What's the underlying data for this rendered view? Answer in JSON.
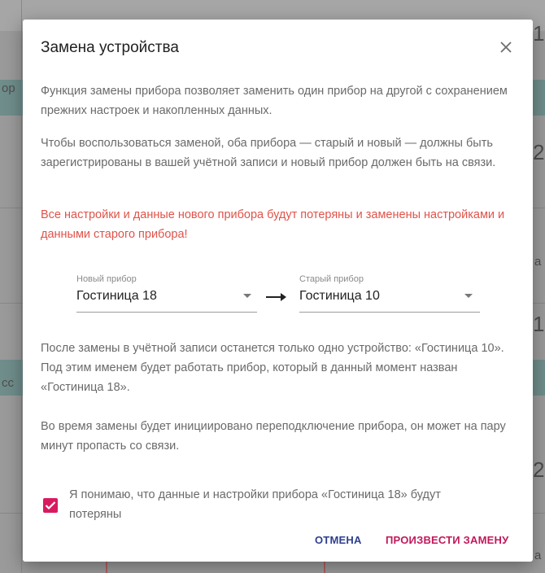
{
  "background": {
    "right_fragments": [
      "1",
      "2",
      "1",
      "2",
      "а",
      "а"
    ],
    "left_fragments": [
      "ор",
      "сс"
    ]
  },
  "dialog": {
    "title": "Замена устройства",
    "close_icon": "close-icon",
    "paragraph_1": "Функция замены прибора позволяет заменить один прибор на другой с сохранением прежних настроек и накопленных данных.",
    "paragraph_2": "Чтобы воспользоваться заменой, оба прибора — старый и новый — должны быть зарегистрированы в вашей учётной записи и новый прибор должен быть на связи.",
    "warning": "Все настройки и данные нового прибора будут потеряны и заменены настройками и данными старого прибора!",
    "new_device": {
      "label": "Новый прибор",
      "value": "Гостиница 18"
    },
    "old_device": {
      "label": "Старый прибор",
      "value": "Гостиница 10"
    },
    "arrow_icon": "arrow-right-icon",
    "paragraph_3": "После замены в учётной записи останется только одно устройство: «Гостиница 10». Под этим именем будет работать прибор, который в данный момент назван «Гостиница 18».",
    "paragraph_4": "Во время замены будет инициировано переподключение прибора, он может на пару минут пропасть со связи.",
    "acknowledge": {
      "checked": true,
      "label": "Я понимаю, что данные и настройки прибора «Гостиница 18» будут потеряны"
    },
    "cancel_label": "ОТМЕНА",
    "confirm_label": "ПРОИЗВЕСТИ ЗАМЕНУ"
  },
  "colors": {
    "accent": "#d81b60",
    "primary_text_button": "#2e3f8f",
    "warning": "#e0534a"
  }
}
